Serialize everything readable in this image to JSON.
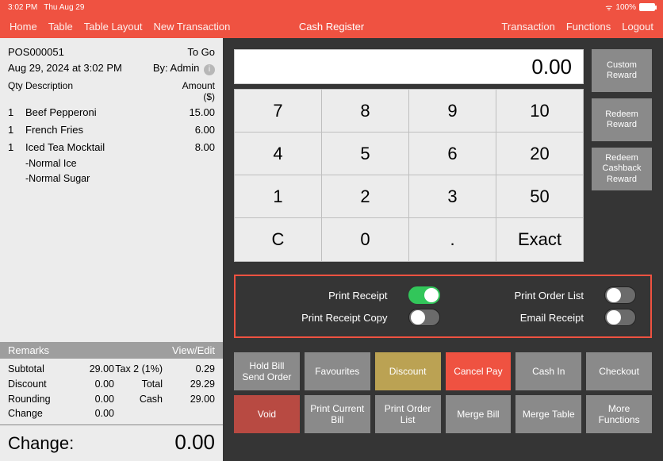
{
  "status": {
    "time": "3:02 PM",
    "date": "Thu Aug 29",
    "battery": "100%"
  },
  "nav": {
    "left": [
      "Home",
      "Table",
      "Table Layout",
      "New Transaction"
    ],
    "center": "Cash Register",
    "right": [
      "Transaction",
      "Functions",
      "Logout"
    ]
  },
  "receipt": {
    "pos_id": "POS000051",
    "order_type": "To Go",
    "datetime": "Aug 29, 2024 at 3:02 PM",
    "by": "By: Admin",
    "cols": {
      "qty": "Qty",
      "desc": "Description",
      "amt": "Amount ($)"
    },
    "items": [
      {
        "qty": "1",
        "name": "Beef Pepperoni",
        "amount": "15.00",
        "subs": []
      },
      {
        "qty": "1",
        "name": "French Fries",
        "amount": "6.00",
        "subs": []
      },
      {
        "qty": "1",
        "name": "Iced Tea Mocktail",
        "amount": "8.00",
        "subs": [
          "-Normal Ice",
          "-Normal Sugar"
        ]
      }
    ],
    "remarks": {
      "label": "Remarks",
      "action": "View/Edit"
    },
    "totals": [
      {
        "l": "Subtotal",
        "v": "29.00",
        "l2": "Tax 2 (1%)",
        "v2": "0.29"
      },
      {
        "l": "Discount",
        "v": "0.00",
        "l2": "Total",
        "v2": "29.29"
      },
      {
        "l": "Rounding",
        "v": "0.00",
        "l2": "Cash",
        "v2": "29.00"
      },
      {
        "l": "Change",
        "v": "0.00",
        "l2": "",
        "v2": ""
      }
    ],
    "change_label": "Change:",
    "change_value": "0.00"
  },
  "calc": {
    "readout": "0.00",
    "keys": [
      [
        "7",
        "8",
        "9",
        "10"
      ],
      [
        "4",
        "5",
        "6",
        "20"
      ],
      [
        "1",
        "2",
        "3",
        "50"
      ],
      [
        "C",
        "0",
        ".",
        "Exact"
      ]
    ]
  },
  "rewards": [
    "Custom Reward",
    "Redeem Reward",
    "Redeem Cashback Reward"
  ],
  "toggles": {
    "print_receipt": {
      "label": "Print Receipt",
      "on": true
    },
    "print_order": {
      "label": "Print Order List",
      "on": false
    },
    "print_copy": {
      "label": "Print Receipt Copy",
      "on": false
    },
    "email": {
      "label": "Email Receipt",
      "on": false
    }
  },
  "fns": {
    "row1": [
      {
        "label": "Hold Bill Send Order",
        "style": ""
      },
      {
        "label": "Favourites",
        "style": ""
      },
      {
        "label": "Discount",
        "style": "gold"
      },
      {
        "label": "Cancel Pay",
        "style": "red"
      },
      {
        "label": "Cash In",
        "style": ""
      },
      {
        "label": "Checkout",
        "style": ""
      }
    ],
    "row2": [
      {
        "label": "Void",
        "style": "dark-red"
      },
      {
        "label": "Print Current Bill",
        "style": ""
      },
      {
        "label": "Print Order List",
        "style": ""
      },
      {
        "label": "Merge Bill",
        "style": ""
      },
      {
        "label": "Merge Table",
        "style": ""
      },
      {
        "label": "More Functions",
        "style": ""
      }
    ]
  }
}
